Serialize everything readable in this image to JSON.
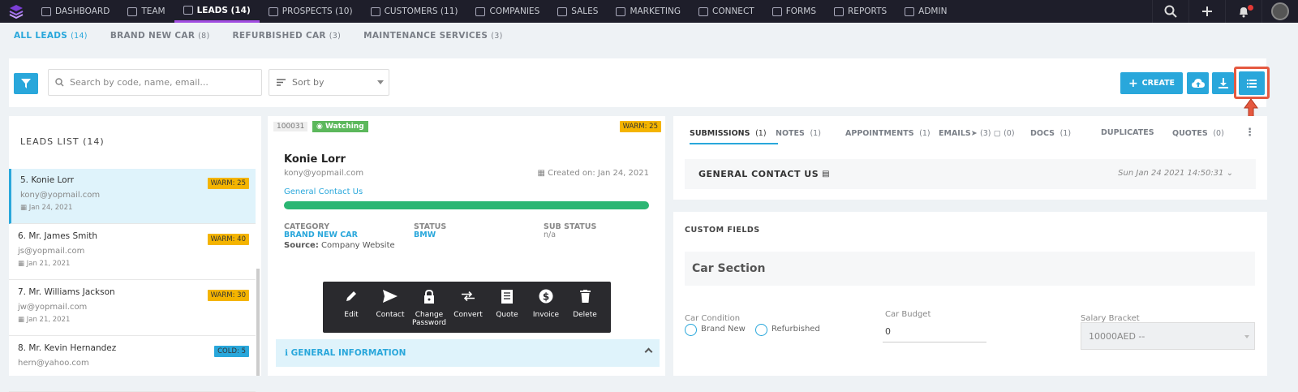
{
  "topnav": {
    "items": [
      {
        "label": "DASHBOARD",
        "icon": "dashboard-icon"
      },
      {
        "label": "TEAM",
        "icon": "team-icon"
      },
      {
        "label": "LEADS (14)",
        "icon": "leads-icon",
        "active": true
      },
      {
        "label": "PROSPECTS (10)",
        "icon": "prospects-icon"
      },
      {
        "label": "CUSTOMERS (11)",
        "icon": "customers-icon"
      },
      {
        "label": "COMPANIES",
        "icon": "companies-icon"
      },
      {
        "label": "SALES",
        "icon": "sales-icon"
      },
      {
        "label": "MARKETING",
        "icon": "marketing-icon"
      },
      {
        "label": "CONNECT",
        "icon": "connect-icon"
      },
      {
        "label": "FORMS",
        "icon": "forms-icon"
      },
      {
        "label": "REPORTS",
        "icon": "reports-icon"
      },
      {
        "label": "ADMIN",
        "icon": "admin-icon"
      }
    ],
    "accent": "#a14de0"
  },
  "subtabs": [
    {
      "label": "ALL LEADS",
      "count": "(14)",
      "active": true
    },
    {
      "label": "BRAND NEW CAR",
      "count": "(8)"
    },
    {
      "label": "REFURBISHED CAR",
      "count": "(3)"
    },
    {
      "label": "MAINTENANCE SERVICES",
      "count": "(3)"
    }
  ],
  "toolbar": {
    "search_placeholder": "Search by code, name, email...",
    "sort_label": "Sort by",
    "create_label": "CREATE"
  },
  "leads_list": {
    "title": "LEADS LIST (14)",
    "items": [
      {
        "name": "5. Konie Lorr",
        "email": "kony@yopmail.com",
        "date": "Jan 24, 2021",
        "badge": "WARM: 25",
        "selected": true
      },
      {
        "name": "6. Mr. James Smith",
        "email": "js@yopmail.com",
        "date": "Jan 21, 2021",
        "badge": "WARM: 40"
      },
      {
        "name": "7. Mr. Williams Jackson",
        "email": "jw@yopmail.com",
        "date": "Jan 21, 2021",
        "badge": "WARM: 30"
      },
      {
        "name": "8. Mr. Kevin Hernandez",
        "email": "hern@yahoo.com",
        "date": "",
        "badge": "COLD: 5"
      }
    ]
  },
  "lead_detail": {
    "code": "100031",
    "watching": "Watching",
    "badge": "WARM: 25",
    "name": "Konie Lorr",
    "email": "kony@yopmail.com",
    "created": "Created on: Jan 24, 2021",
    "form": "General Contact Us",
    "progress": 1.0,
    "category_label": "CATEGORY",
    "category": "BRAND NEW CAR",
    "status_label": "STATUS",
    "status": "BMW",
    "substatus_label": "SUB STATUS",
    "substatus": "n/a",
    "source_label": "Source:",
    "source": "Company Website",
    "general_info": "GENERAL INFORMATION"
  },
  "actions": [
    "Edit",
    "Contact",
    "Change Password",
    "Convert",
    "Quote",
    "Invoice",
    "Delete"
  ],
  "right_tabs": [
    {
      "label": "SUBMISSIONS",
      "count": "(1)",
      "active": true
    },
    {
      "label": "NOTES",
      "count": "(1)"
    },
    {
      "label": "APPOINTMENTS",
      "count": "(1)"
    },
    {
      "label": "EMAILS",
      "count": "(3)",
      "extra": "(0)"
    },
    {
      "label": "DOCS",
      "count": "(1)"
    },
    {
      "label": "DUPLICATES",
      "count": ""
    },
    {
      "label": "QUOTES",
      "count": "(0)"
    }
  ],
  "submission": {
    "title": "GENERAL CONTACT US",
    "date": "Sun Jan 24 2021 14:50:31"
  },
  "custom_fields": {
    "title": "CUSTOM FIELDS",
    "section": "Car Section",
    "car_condition_label": "Car Condition",
    "options": [
      "Brand New",
      "Refurbished"
    ],
    "car_budget_label": "Car Budget",
    "car_budget_value": "0",
    "salary_label": "Salary Bracket",
    "salary_value": "10000AED --"
  },
  "colors": {
    "primary": "#29a7db",
    "warm": "#f4b400",
    "success": "#2bb673",
    "highlight": "#e55940"
  }
}
